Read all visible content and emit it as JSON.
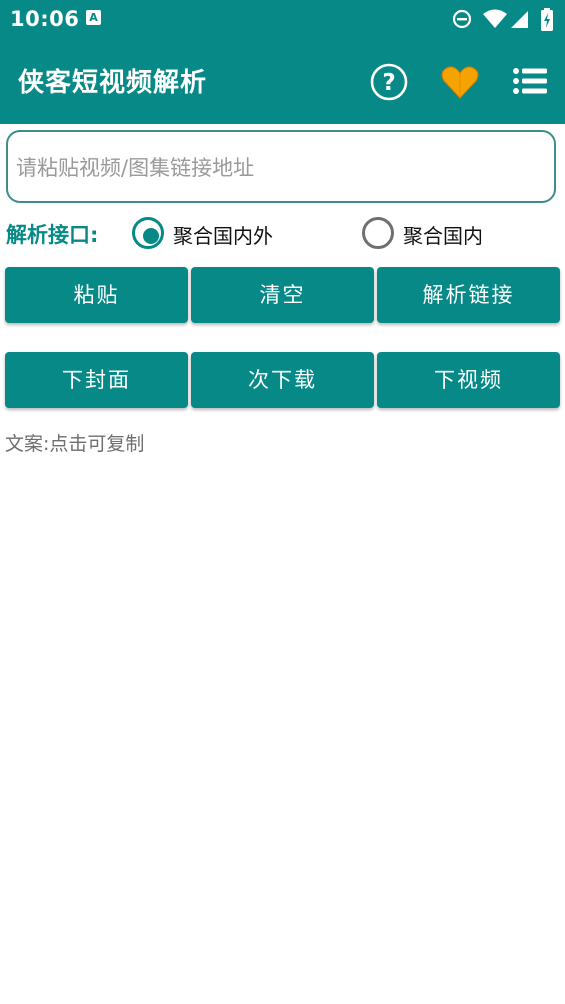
{
  "status_bar": {
    "time": "10:06",
    "notification_badge": "A",
    "icons": [
      "do-not-disturb-icon",
      "wifi-icon",
      "cell-signal-icon",
      "battery-charging-icon"
    ]
  },
  "toolbar": {
    "title": "侠客短视频解析",
    "actions": [
      {
        "name": "help-icon",
        "glyph": "?"
      },
      {
        "name": "heart-icon"
      },
      {
        "name": "menu-list-icon"
      }
    ]
  },
  "url_input": {
    "placeholder": "请粘贴视频/图集链接地址",
    "value": ""
  },
  "api_selector": {
    "label": "解析接口:",
    "options": [
      {
        "label": "聚合国内外",
        "checked": true
      },
      {
        "label": "聚合国内",
        "checked": false
      }
    ]
  },
  "actions_row1": {
    "paste": "粘贴",
    "clear": "清空",
    "parse": "解析链接"
  },
  "actions_row2": {
    "download_cover": "下封面",
    "download_again": "次下载",
    "download_video": "下视频"
  },
  "caption": {
    "text": "文案:点击可复制"
  },
  "colors": {
    "primary": "#078a87",
    "heart": "#f6a300",
    "text_secondary": "#6e6e6e"
  }
}
